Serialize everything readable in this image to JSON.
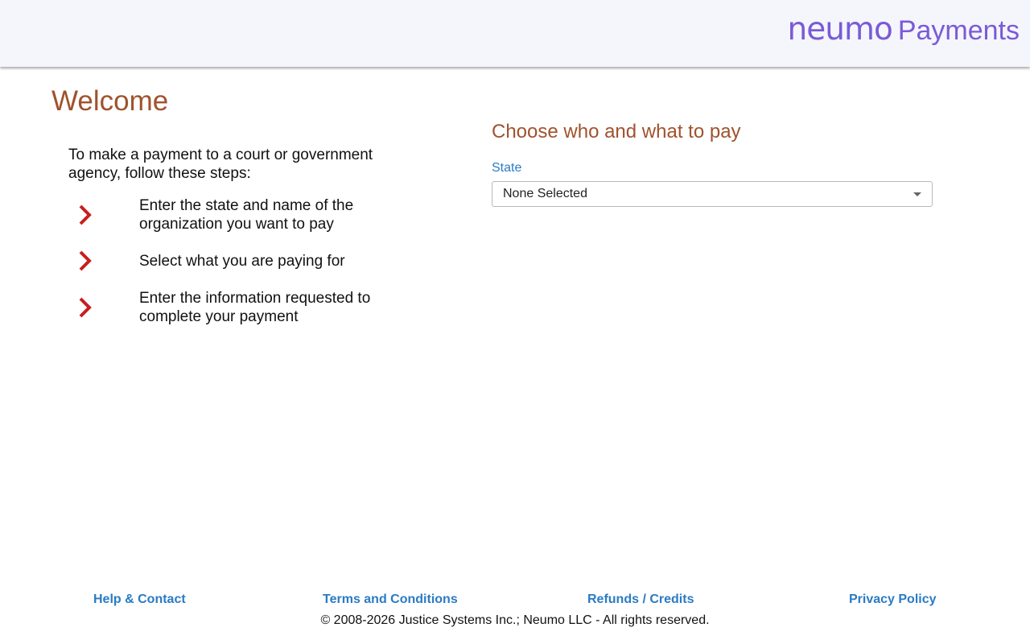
{
  "header": {
    "logo_brand": "neumo",
    "logo_product": "Payments"
  },
  "welcome": {
    "title": "Welcome",
    "intro": "To make a payment to a court or government agency, follow these steps:",
    "steps": [
      {
        "icon": "chevron-right-icon",
        "text": "Enter the state and name of the organization you want to pay"
      },
      {
        "icon": "chevron-right-icon",
        "text": "Select what you are paying for"
      },
      {
        "icon": "chevron-right-icon",
        "text": "Enter the information requested to complete your payment"
      }
    ]
  },
  "form": {
    "title": "Choose who and what to pay",
    "state_label": "State",
    "state_value": "None Selected"
  },
  "footer": {
    "links": [
      "Help & Contact",
      "Terms and Conditions",
      "Refunds / Credits",
      "Privacy Policy"
    ],
    "copyright": "© 2008-2026 Justice Systems Inc.; Neumo LLC - All rights reserved."
  },
  "colors": {
    "header_bg": "#f5f5fc",
    "brand": "#7a5bd6",
    "heading": "#a0522d",
    "link": "#2a7bc4",
    "chevron": "#c81e1e"
  }
}
